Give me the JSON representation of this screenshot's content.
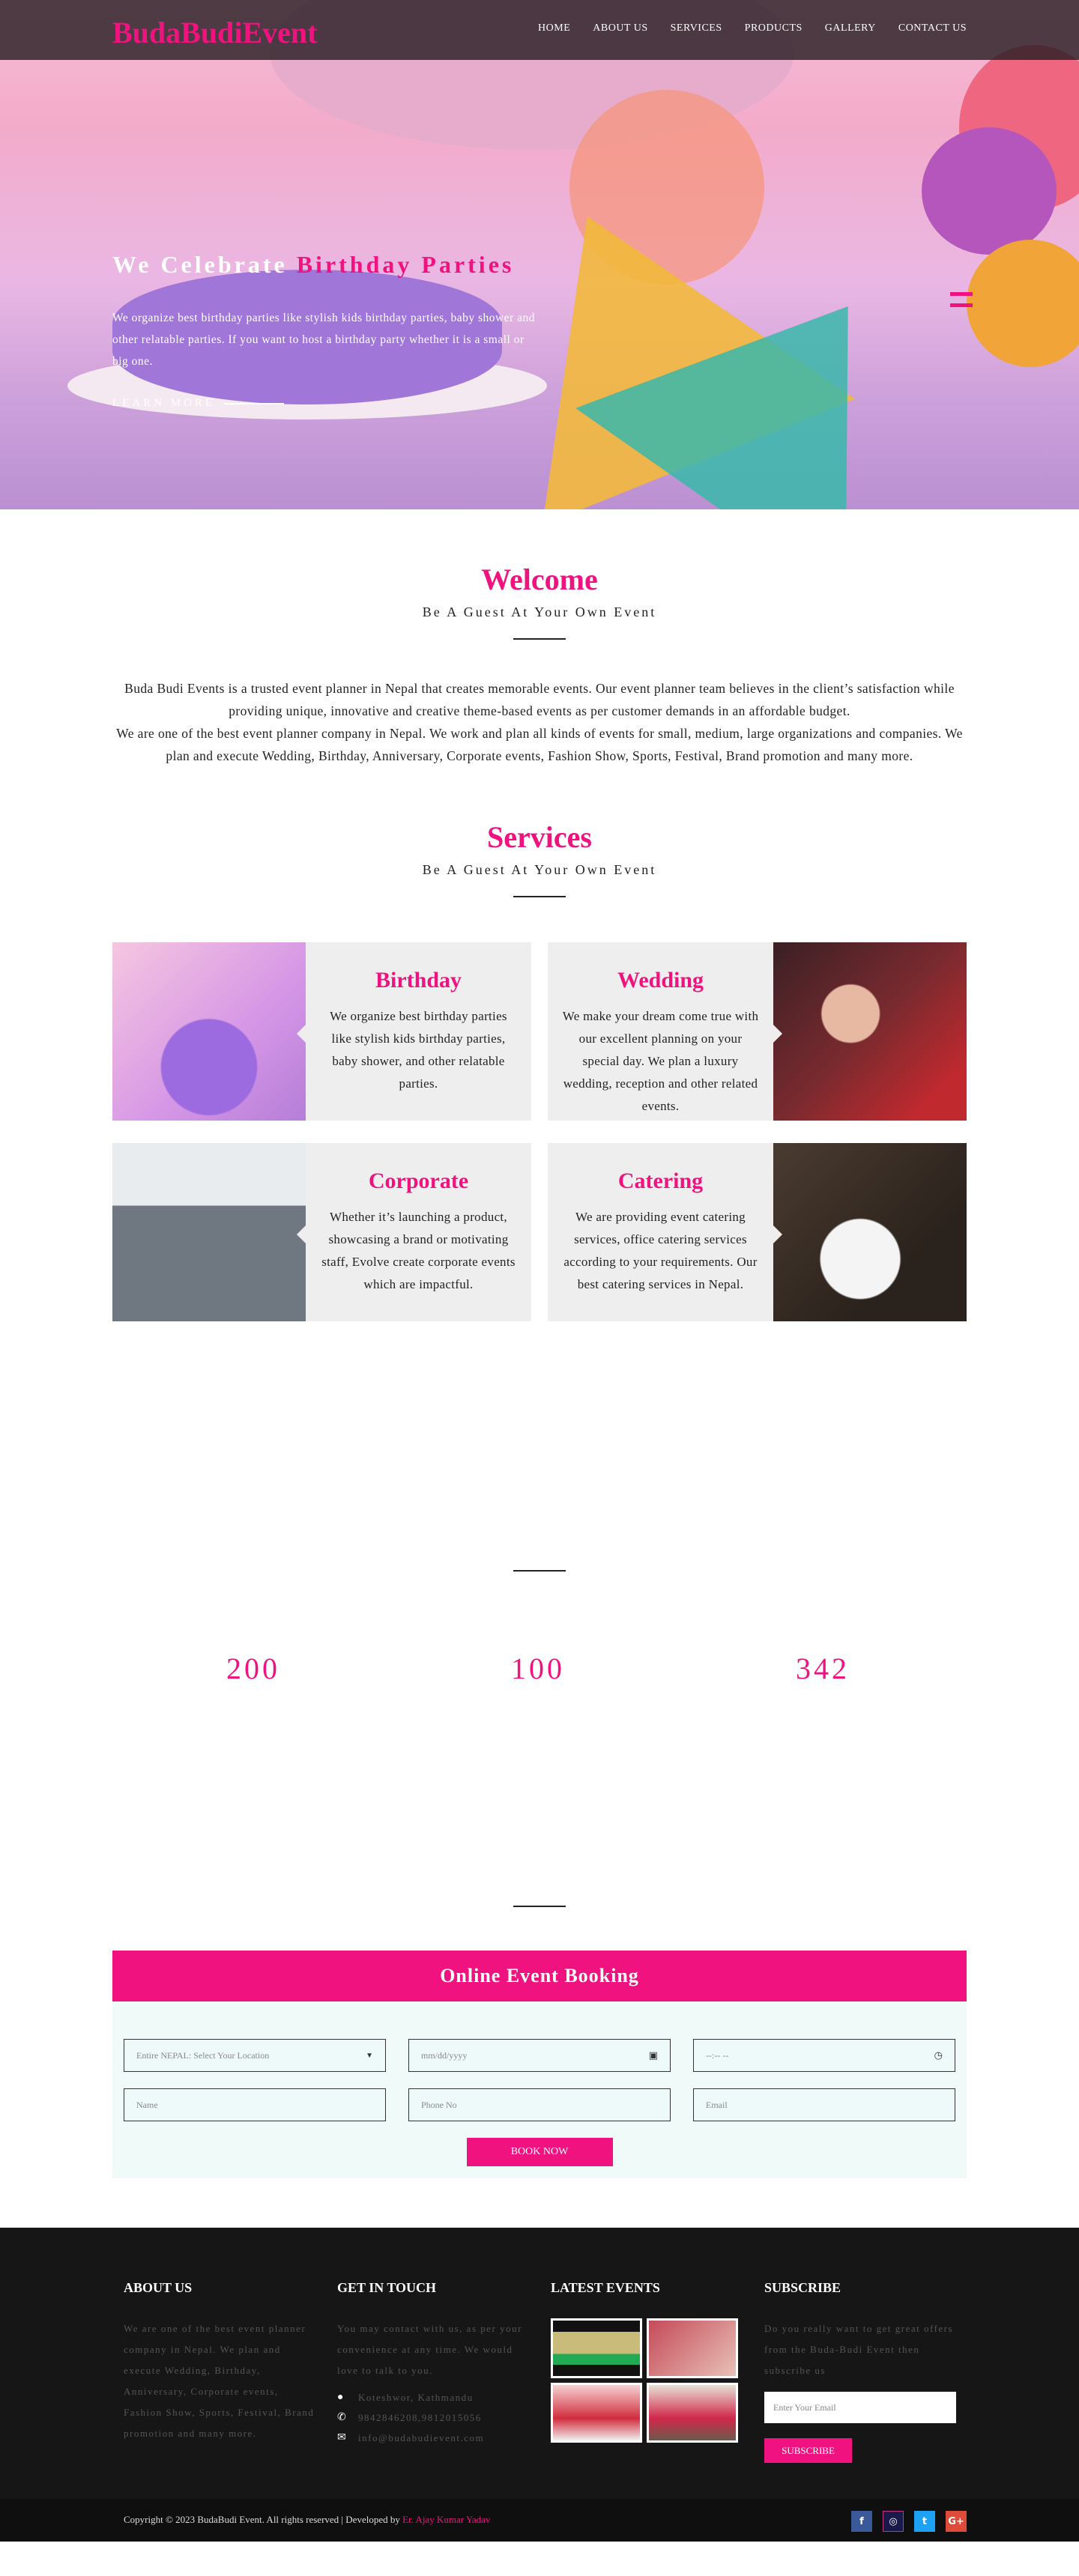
{
  "nav": {
    "logo": "BudaBudiEvent",
    "items": [
      "HOME",
      "ABOUT US",
      "SERVICES",
      "PRODUCTS",
      "GALLERY",
      "CONTACT US"
    ]
  },
  "hero": {
    "title_white": "We Celebrate",
    "title_pink": "Birthday Parties",
    "description": "We organize best birthday parties like stylish kids birthday parties, baby shower and other relatable parties. If you want to host a birthday party whether it is a small or big one.",
    "cta": "LEARN MORE"
  },
  "welcome": {
    "title": "Welcome",
    "subtitle": "Be A Guest At Your Own Event",
    "para1": "Buda Budi Events is a trusted event planner in Nepal that creates memorable events. Our event planner team believes in the client’s satisfaction while providing unique, innovative and creative theme-based events as per customer demands in an affordable budget.",
    "para2": "We are one of the best event planner company in Nepal. We work and plan all kinds of events for small, medium, large organizations and companies. We plan and execute Wedding, Birthday, Anniversary, Corporate events, Fashion Show, Sports, Festival, Brand promotion and many more."
  },
  "services": {
    "title": "Services",
    "subtitle": "Be A Guest At Your Own Event",
    "cards": [
      {
        "title": "Birthday",
        "text": "We organize best birthday parties like stylish kids birthday parties, baby shower, and other relatable parties."
      },
      {
        "title": "Wedding",
        "text": "We make your dream come true with our excellent planning on your special day. We plan a luxury wedding, reception and other related events."
      },
      {
        "title": "Corporate",
        "text": "Whether it’s launching a product, showcasing a brand or motivating staff, Evolve create corporate events which are impactful."
      },
      {
        "title": "Catering",
        "text": "We are providing event catering services, office catering services according to your requirements. Our best catering services in Nepal."
      }
    ]
  },
  "counters": [
    "200",
    "100",
    "342"
  ],
  "booking": {
    "title": "Online Event Booking",
    "location_placeholder": "Entire NEPAL: Select Your Location",
    "date_placeholder": "mm/dd/yyyy",
    "time_placeholder": "--:-- --",
    "name_placeholder": "Name",
    "phone_placeholder": "Phone No",
    "email_placeholder": "Email",
    "button": "BOOK NOW"
  },
  "footer": {
    "about_title": "ABOUT US",
    "about_text": "We are one of the best event planner company in Nepal. We plan and execute Wedding, Birthday, Anniversary, Corporate events, Fashion Show, Sports, Festival, Brand promotion and many more.",
    "touch_title": "GET IN TOUCH",
    "touch_text": "You may contact with us, as per your convenience at any time. We would love to talk to you.",
    "address": "Koteshwor, Kathmandu",
    "phone": "9842846208,9812015056",
    "email": "info@budabudievent.com",
    "events_title": "LATEST EVENTS",
    "subscribe_title": "SUBSCRIBE",
    "subscribe_text": "Do you really want to get great offers from the Buda-Budi Event then subscribe us",
    "subscribe_placeholder": "Enter Your Email",
    "subscribe_button": "SUBSCRIBE",
    "copyright": "Copyright © 2023 BudaBudi Event. All rights reserved | Developed by",
    "developer": "Er. Ajay Kumar Yadav",
    "socials": [
      {
        "name": "facebook-icon",
        "glyph": "f",
        "color": "#3b5998"
      },
      {
        "name": "instagram-icon",
        "glyph": "◎",
        "color": "#1a1a4a"
      },
      {
        "name": "twitter-icon",
        "glyph": "t",
        "color": "#1da1f2"
      },
      {
        "name": "google-plus-icon",
        "glyph": "G+",
        "color": "#dd4b39"
      }
    ]
  }
}
